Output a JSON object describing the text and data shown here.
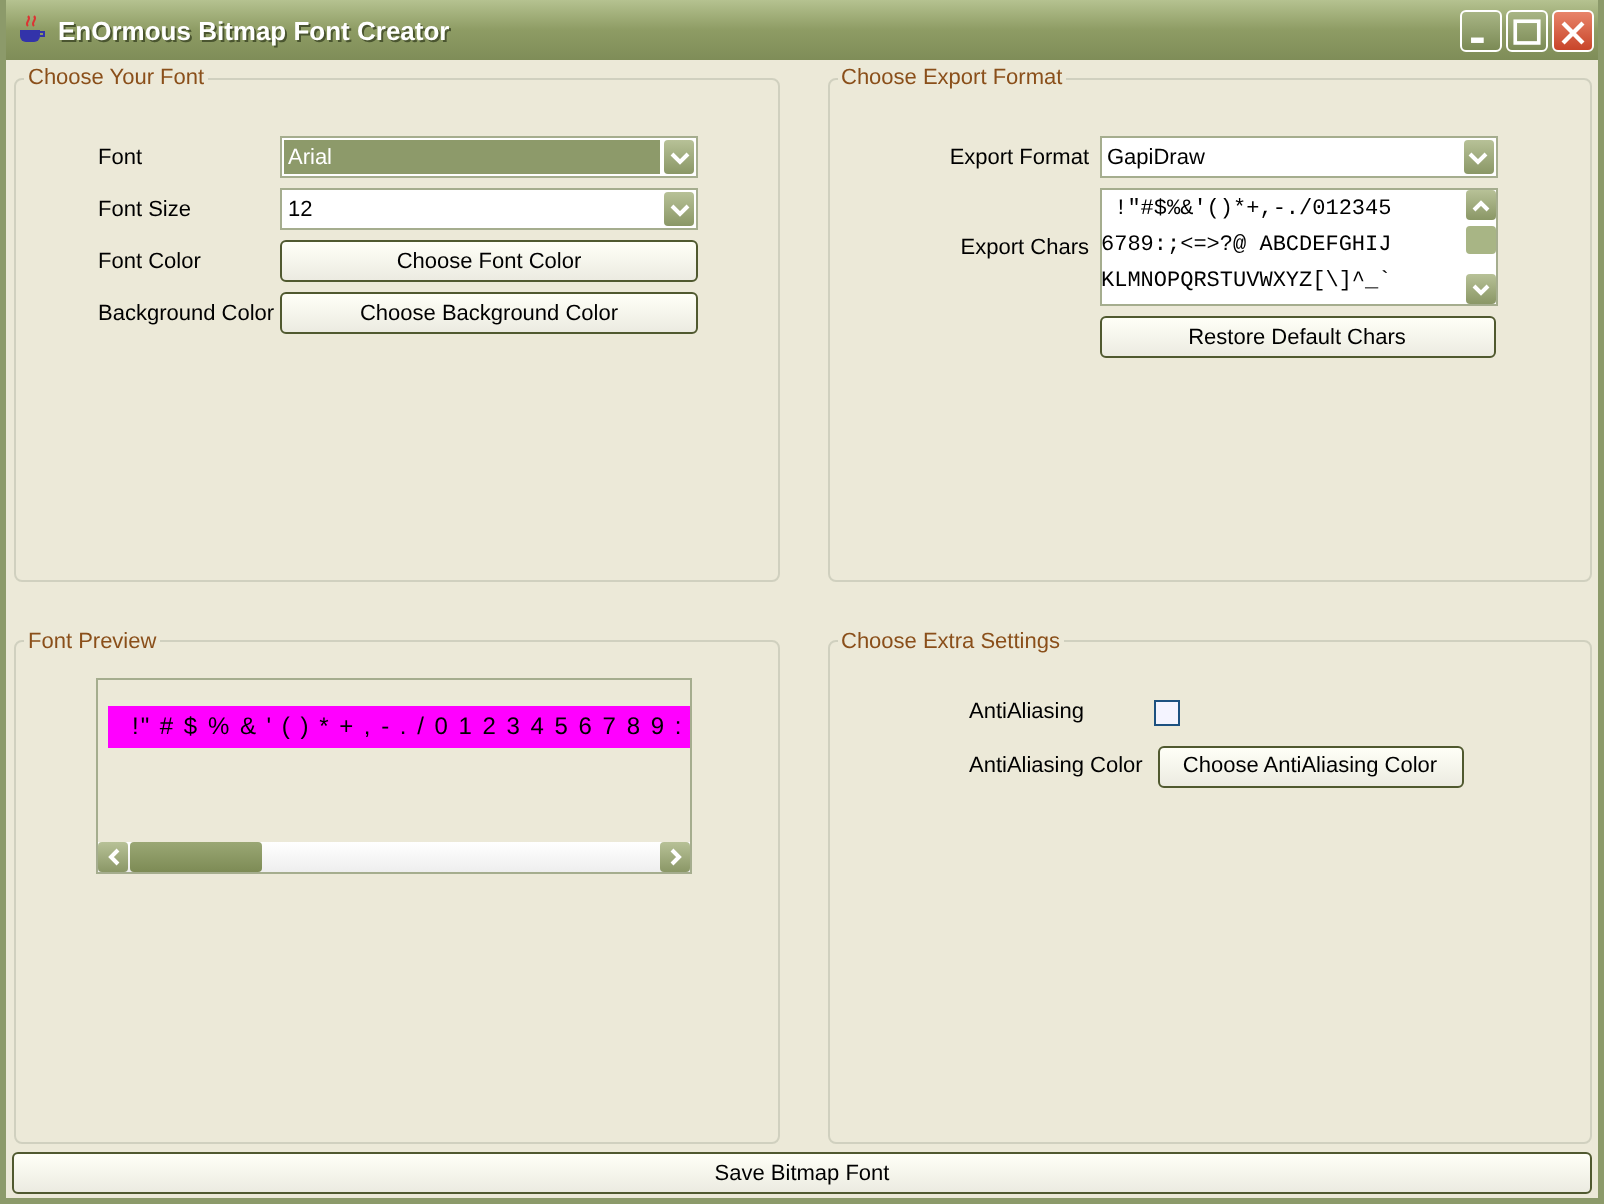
{
  "window": {
    "title": "EnOrmous Bitmap Font Creator"
  },
  "font_panel": {
    "title": "Choose Your Font",
    "rows": [
      {
        "kind": "dropdown",
        "label": "Font",
        "value": "Arial",
        "highlighted": true
      },
      {
        "kind": "dropdown",
        "label": "Font Size",
        "value": "12",
        "highlighted": false
      },
      {
        "kind": "button",
        "label": "Font Color",
        "button": "Choose Font Color"
      },
      {
        "kind": "button",
        "label": "Background Color",
        "button": "Choose Background Color"
      }
    ]
  },
  "export_panel": {
    "title": "Choose Export Format",
    "format": {
      "label": "Export Format",
      "value": "GapiDraw"
    },
    "chars": {
      "label": "Export Chars",
      "lines": [
        " !\"#$%&'()*+,-./012345",
        "6789:;<=>?@ ABCDEFGHIJ",
        "KLMNOPQRSTUVWXYZ[\\]^_`"
      ]
    },
    "restore_button": "Restore Default Chars"
  },
  "preview_panel": {
    "title": "Font Preview",
    "preview_text": "!\" # $ % & ' ( ) * + , - . / 0 1 2 3 4 5 6 7 8 9 :"
  },
  "extra_panel": {
    "title": "Choose Extra Settings",
    "antialiasing": {
      "label": "AntiAliasing",
      "checked": false
    },
    "aa_color": {
      "label": "AntiAliasing Color",
      "button": "Choose AntiAliasing Color"
    }
  },
  "save_button": "Save Bitmap Font"
}
